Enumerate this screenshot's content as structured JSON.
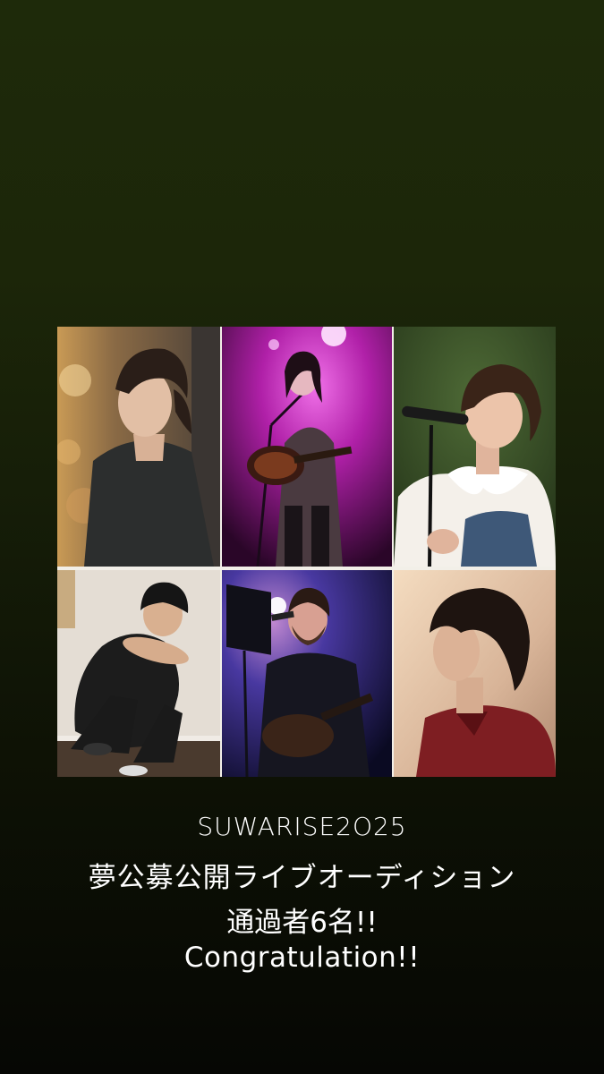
{
  "photos": [
    {
      "subject": "woman-in-hoodie-profile"
    },
    {
      "subject": "guitarist-singer-pink-stage"
    },
    {
      "subject": "singer-at-microphone-green"
    },
    {
      "subject": "dancer-crouching-beanie"
    },
    {
      "subject": "guitarist-singer-blue-stage"
    },
    {
      "subject": "man-red-shirt-profile"
    }
  ],
  "caption": {
    "line1": "SUWARISE2O25",
    "line2": "夢公募公開ライブオーディション",
    "line3": "通過者6名!!",
    "line4": "Congratulation!!"
  }
}
